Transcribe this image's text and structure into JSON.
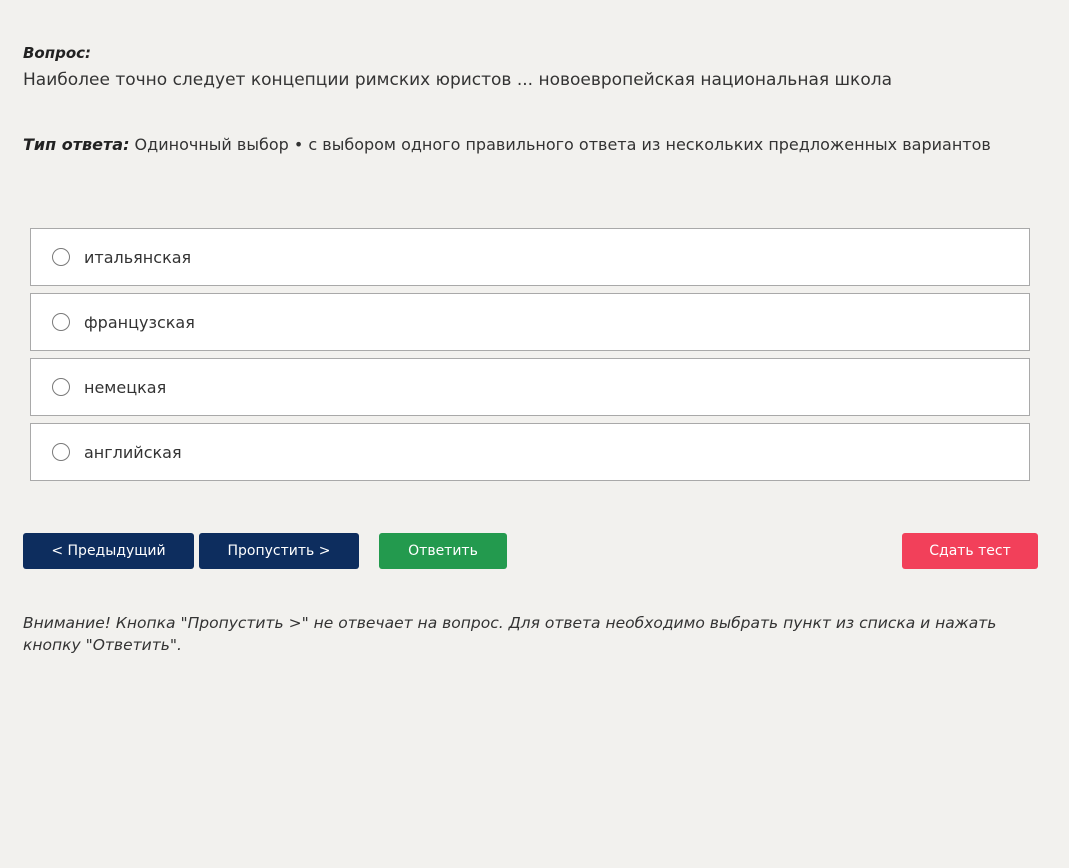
{
  "question": {
    "label": "Вопрос:",
    "text": "Наиболее точно следует концепции римских юристов ... новоевропейская национальная школа"
  },
  "answer_type": {
    "label": "Тип ответа:",
    "value": " Одиночный выбор • с выбором одного правильного ответа из нескольких предложенных вариантов"
  },
  "options": [
    {
      "label": "итальянская",
      "selected": false
    },
    {
      "label": "французская",
      "selected": false
    },
    {
      "label": "немецкая",
      "selected": false
    },
    {
      "label": "английская",
      "selected": false
    }
  ],
  "buttons": {
    "prev_label": "< Предыдущий",
    "skip_label": "Пропустить >",
    "answer_label": "Ответить",
    "submit_label": "Сдать тест"
  },
  "colors": {
    "background": "#f2f1ee",
    "nav_button": "#0d2d5e",
    "answer_button": "#239a4e",
    "submit_button": "#f2405a"
  },
  "warning": {
    "text": "Внимание! Кнопка \"Пропустить >\" не отвечает на вопрос. Для ответа необходимо выбрать пункт из списка и нажать кнопку \"Ответить\"."
  }
}
